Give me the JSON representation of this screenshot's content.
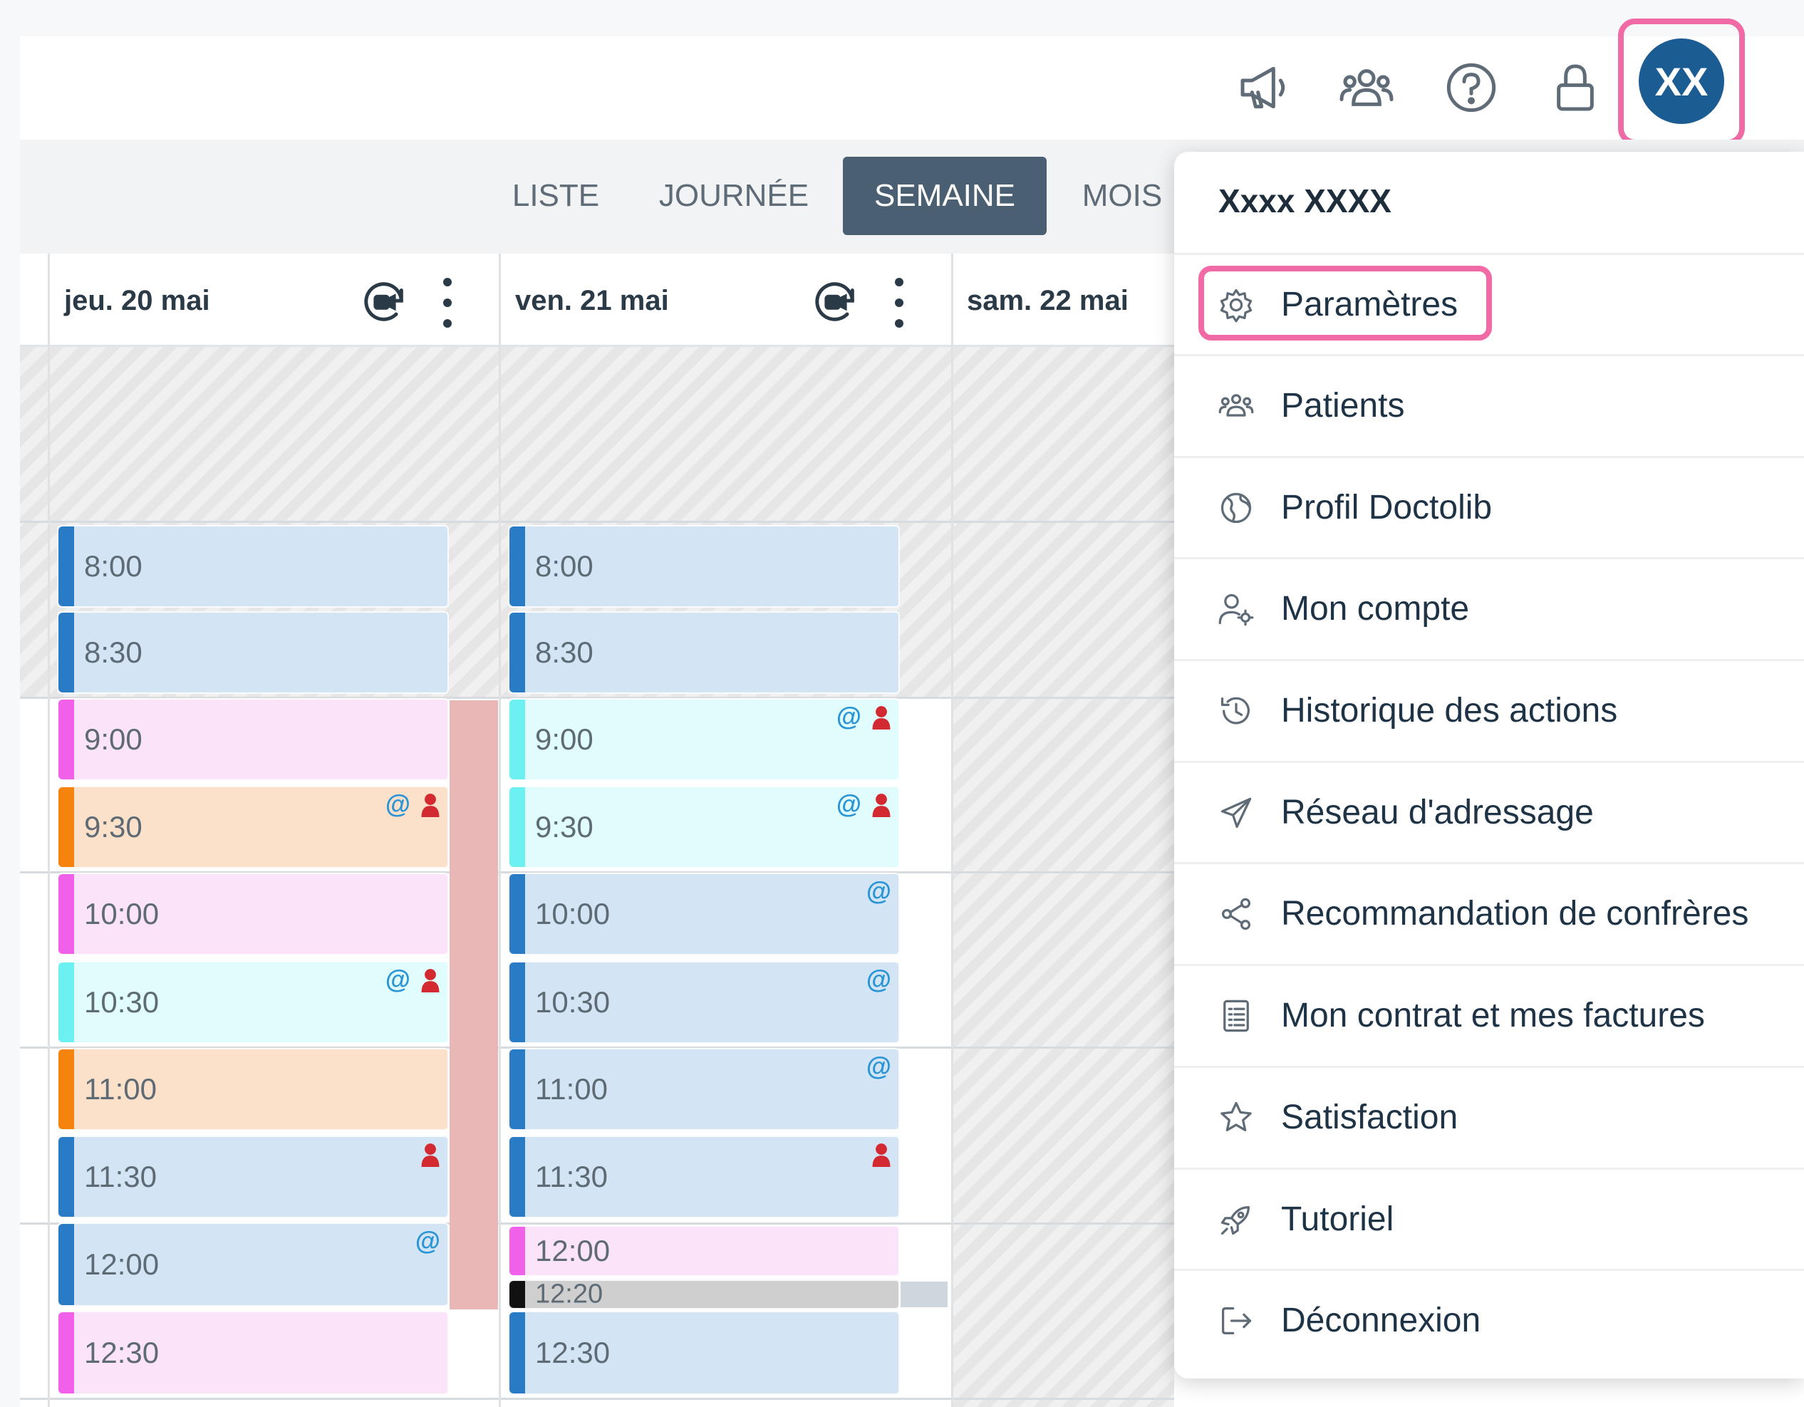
{
  "header": {
    "icons": [
      "megaphone-icon",
      "team-icon",
      "help-icon",
      "lock-icon"
    ],
    "avatar_initials": "XX",
    "colors": {
      "avatar": "#1b5c93",
      "highlight": "#f06aa6"
    }
  },
  "view_tabs": [
    {
      "label": "LISTE",
      "active": false
    },
    {
      "label": "JOURNÉE",
      "active": false
    },
    {
      "label": "SEMAINE",
      "active": true
    },
    {
      "label": "MOIS",
      "active": false
    }
  ],
  "days": [
    {
      "label": "jeu. 20 mai",
      "icons": [
        "video-refresh-icon",
        "more-vertical-icon"
      ]
    },
    {
      "label": "ven. 21 mai",
      "icons": [
        "video-refresh-icon",
        "more-vertical-icon"
      ]
    },
    {
      "label": "sam. 22 mai"
    }
  ],
  "appointments": {
    "thu": [
      {
        "time": "8:00",
        "color": "blue",
        "email": false,
        "person": false
      },
      {
        "time": "8:30",
        "color": "blue",
        "email": false,
        "person": false
      },
      {
        "time": "9:00",
        "color": "pink",
        "email": false,
        "person": false
      },
      {
        "time": "9:30",
        "color": "orange",
        "email": true,
        "person": true
      },
      {
        "time": "10:00",
        "color": "pink",
        "email": false,
        "person": false
      },
      {
        "time": "10:30",
        "color": "cyan",
        "email": true,
        "person": true
      },
      {
        "time": "11:00",
        "color": "orange",
        "email": false,
        "person": false
      },
      {
        "time": "11:30",
        "color": "blue",
        "email": false,
        "person": true
      },
      {
        "time": "12:00",
        "color": "blue",
        "email": true,
        "person": false
      },
      {
        "time": "12:30",
        "color": "pink",
        "email": false,
        "person": false
      }
    ],
    "fri": [
      {
        "time": "8:00",
        "color": "blue",
        "email": false,
        "person": false
      },
      {
        "time": "8:30",
        "color": "blue",
        "email": false,
        "person": false
      },
      {
        "time": "9:00",
        "color": "cyan",
        "email": true,
        "person": true
      },
      {
        "time": "9:30",
        "color": "cyan",
        "email": true,
        "person": true
      },
      {
        "time": "10:00",
        "color": "blue",
        "email": true,
        "person": false
      },
      {
        "time": "10:30",
        "color": "blue",
        "email": true,
        "person": false
      },
      {
        "time": "11:00",
        "color": "blue",
        "email": true,
        "person": false
      },
      {
        "time": "11:30",
        "color": "blue",
        "email": false,
        "person": true
      },
      {
        "time": "12:00",
        "color": "pink",
        "email": false,
        "person": false
      },
      {
        "time": "12:20",
        "color": "gray",
        "email": false,
        "person": false
      },
      {
        "time": "12:30",
        "color": "blue",
        "email": false,
        "person": false
      }
    ]
  },
  "badge_text": {
    "email": "@"
  },
  "palette": {
    "blue": {
      "bg": "#d3e5f4",
      "bar": "#2a7bc6"
    },
    "pink": {
      "bg": "#fbe3fa",
      "bar": "#f060e8"
    },
    "orange": {
      "bg": "#fbe1ca",
      "bar": "#f5830e"
    },
    "cyan": {
      "bg": "#e1fcfd",
      "bar": "#6cf0f2"
    },
    "gray": {
      "bg": "#cfcfcf",
      "bar": "#111111"
    }
  },
  "menu": {
    "user_name": "Xxxx XXXX",
    "items": [
      {
        "label": "Paramètres",
        "icon": "gear-icon",
        "highlighted": true
      },
      {
        "label": "Patients",
        "icon": "patients-icon"
      },
      {
        "label": "Profil Doctolib",
        "icon": "globe-icon"
      },
      {
        "label": "Mon compte",
        "icon": "user-settings-icon"
      },
      {
        "label": "Historique des actions",
        "icon": "history-icon"
      },
      {
        "label": "Réseau d'adressage",
        "icon": "paper-plane-icon"
      },
      {
        "label": "Recommandation de confrères",
        "icon": "share-icon"
      },
      {
        "label": "Mon contrat et mes factures",
        "icon": "contract-icon"
      },
      {
        "label": "Satisfaction",
        "icon": "star-icon"
      },
      {
        "label": "Tutoriel",
        "icon": "rocket-icon"
      },
      {
        "label": "Déconnexion",
        "icon": "logout-icon"
      }
    ]
  }
}
